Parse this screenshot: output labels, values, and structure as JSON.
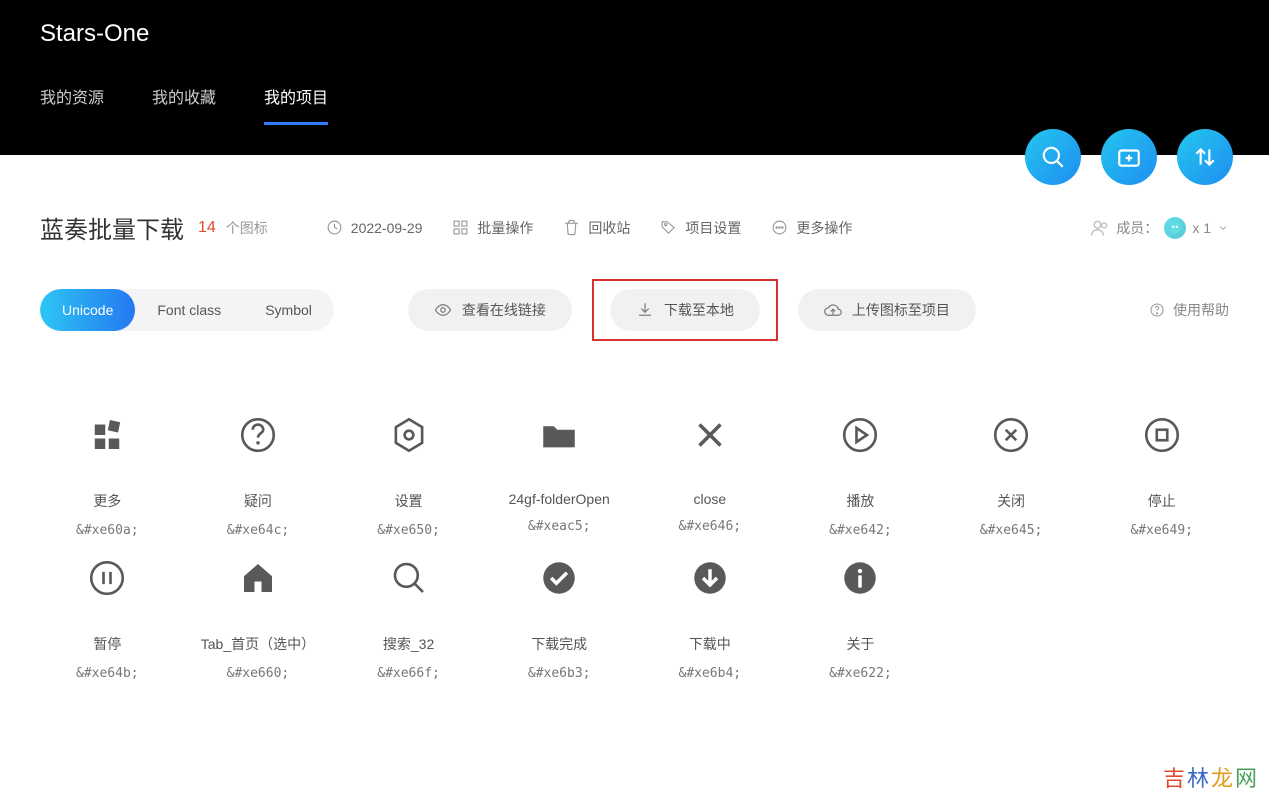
{
  "header": {
    "brand": "Stars-One",
    "tabs": [
      "我的资源",
      "我的收藏",
      "我的项目"
    ],
    "activeTab": 2
  },
  "project": {
    "title": "蓝奏批量下载",
    "count": "14",
    "countLabel": "个图标",
    "date": "2022-09-29",
    "meta": {
      "batch": "批量操作",
      "recycle": "回收站",
      "settings": "项目设置",
      "more": "更多操作"
    },
    "members": {
      "label": "成员：",
      "count": "x 1"
    }
  },
  "toolbar": {
    "seg": [
      "Unicode",
      "Font class",
      "Symbol"
    ],
    "segActive": 0,
    "viewOnline": "查看在线链接",
    "downloadLocal": "下载至本地",
    "upload": "上传图标至项目",
    "help": "使用帮助"
  },
  "icons": [
    {
      "name": "更多",
      "code": "&#xe60a;",
      "glyph": "more"
    },
    {
      "name": "疑问",
      "code": "&#xe64c;",
      "glyph": "question"
    },
    {
      "name": "设置",
      "code": "&#xe650;",
      "glyph": "settings"
    },
    {
      "name": "24gf-folderOpen",
      "code": "&#xeac5;",
      "glyph": "folder"
    },
    {
      "name": "close",
      "code": "&#xe646;",
      "glyph": "x"
    },
    {
      "name": "播放",
      "code": "&#xe642;",
      "glyph": "play"
    },
    {
      "name": "关闭",
      "code": "&#xe645;",
      "glyph": "xcircle"
    },
    {
      "name": "停止",
      "code": "&#xe649;",
      "glyph": "stop"
    },
    {
      "name": "暂停",
      "code": "&#xe64b;",
      "glyph": "pause"
    },
    {
      "name": "Tab_首页（选中）",
      "code": "&#xe660;",
      "glyph": "home"
    },
    {
      "name": "搜索_32",
      "code": "&#xe66f;",
      "glyph": "search"
    },
    {
      "name": "下载完成",
      "code": "&#xe6b3;",
      "glyph": "check"
    },
    {
      "name": "下载中",
      "code": "&#xe6b4;",
      "glyph": "download"
    },
    {
      "name": "关于",
      "code": "&#xe622;",
      "glyph": "info"
    }
  ],
  "watermark": [
    "吉",
    "林",
    "龙",
    "网"
  ]
}
